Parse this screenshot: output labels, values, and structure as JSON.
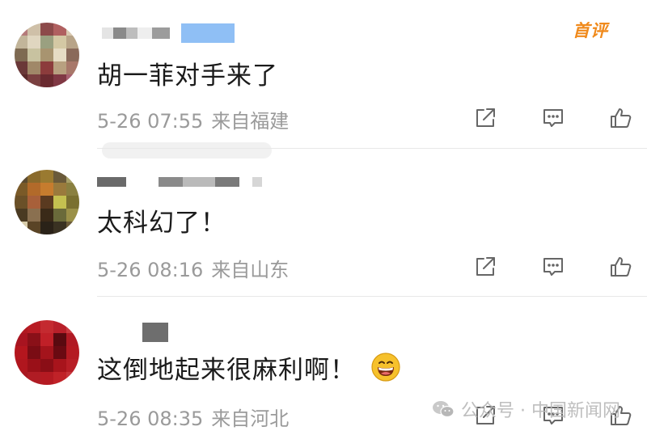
{
  "comments": [
    {
      "text": "胡一菲对手来了",
      "date": "5-26 07:55",
      "location": "来自福建",
      "badge": "首评"
    },
    {
      "text": "太科幻了！",
      "date": "5-26 08:16",
      "location": "来自山东"
    },
    {
      "text": "这倒地起来很麻利啊！",
      "date": "5-26 08:35",
      "location": "来自河北",
      "emoji": "grinning-face-emoji"
    }
  ],
  "watermark": {
    "text": "公众号 · 中国新闻网",
    "icon": "wechat-icon"
  },
  "icons": {
    "share": "share-icon",
    "reply": "comment-icon",
    "like": "thumbs-up-icon"
  },
  "colors": {
    "badge": "#f08a1c",
    "meta": "#9a9a9a",
    "text": "#1b1b1b",
    "icon": "#666666"
  }
}
